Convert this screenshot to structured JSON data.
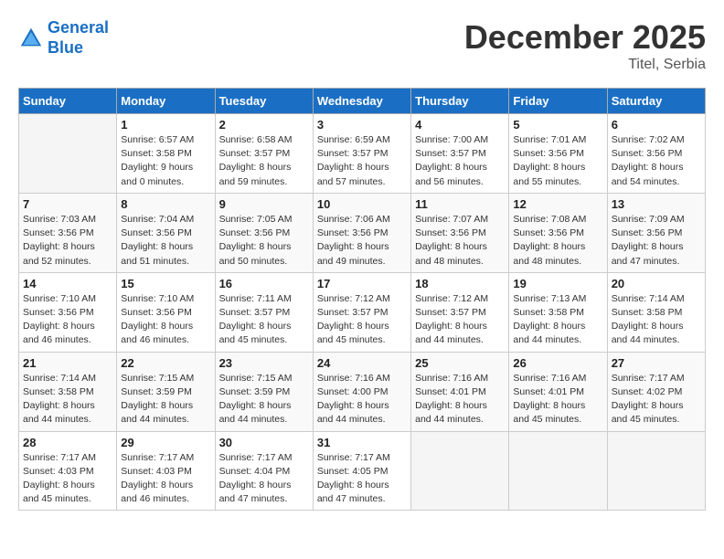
{
  "header": {
    "logo_line1": "General",
    "logo_line2": "Blue",
    "title": "December 2025",
    "subtitle": "Titel, Serbia"
  },
  "columns": [
    "Sunday",
    "Monday",
    "Tuesday",
    "Wednesday",
    "Thursday",
    "Friday",
    "Saturday"
  ],
  "weeks": [
    [
      {
        "day": "",
        "info": ""
      },
      {
        "day": "1",
        "info": "Sunrise: 6:57 AM\nSunset: 3:58 PM\nDaylight: 9 hours\nand 0 minutes."
      },
      {
        "day": "2",
        "info": "Sunrise: 6:58 AM\nSunset: 3:57 PM\nDaylight: 8 hours\nand 59 minutes."
      },
      {
        "day": "3",
        "info": "Sunrise: 6:59 AM\nSunset: 3:57 PM\nDaylight: 8 hours\nand 57 minutes."
      },
      {
        "day": "4",
        "info": "Sunrise: 7:00 AM\nSunset: 3:57 PM\nDaylight: 8 hours\nand 56 minutes."
      },
      {
        "day": "5",
        "info": "Sunrise: 7:01 AM\nSunset: 3:56 PM\nDaylight: 8 hours\nand 55 minutes."
      },
      {
        "day": "6",
        "info": "Sunrise: 7:02 AM\nSunset: 3:56 PM\nDaylight: 8 hours\nand 54 minutes."
      }
    ],
    [
      {
        "day": "7",
        "info": "Sunrise: 7:03 AM\nSunset: 3:56 PM\nDaylight: 8 hours\nand 52 minutes."
      },
      {
        "day": "8",
        "info": "Sunrise: 7:04 AM\nSunset: 3:56 PM\nDaylight: 8 hours\nand 51 minutes."
      },
      {
        "day": "9",
        "info": "Sunrise: 7:05 AM\nSunset: 3:56 PM\nDaylight: 8 hours\nand 50 minutes."
      },
      {
        "day": "10",
        "info": "Sunrise: 7:06 AM\nSunset: 3:56 PM\nDaylight: 8 hours\nand 49 minutes."
      },
      {
        "day": "11",
        "info": "Sunrise: 7:07 AM\nSunset: 3:56 PM\nDaylight: 8 hours\nand 48 minutes."
      },
      {
        "day": "12",
        "info": "Sunrise: 7:08 AM\nSunset: 3:56 PM\nDaylight: 8 hours\nand 48 minutes."
      },
      {
        "day": "13",
        "info": "Sunrise: 7:09 AM\nSunset: 3:56 PM\nDaylight: 8 hours\nand 47 minutes."
      }
    ],
    [
      {
        "day": "14",
        "info": "Sunrise: 7:10 AM\nSunset: 3:56 PM\nDaylight: 8 hours\nand 46 minutes."
      },
      {
        "day": "15",
        "info": "Sunrise: 7:10 AM\nSunset: 3:56 PM\nDaylight: 8 hours\nand 46 minutes."
      },
      {
        "day": "16",
        "info": "Sunrise: 7:11 AM\nSunset: 3:57 PM\nDaylight: 8 hours\nand 45 minutes."
      },
      {
        "day": "17",
        "info": "Sunrise: 7:12 AM\nSunset: 3:57 PM\nDaylight: 8 hours\nand 45 minutes."
      },
      {
        "day": "18",
        "info": "Sunrise: 7:12 AM\nSunset: 3:57 PM\nDaylight: 8 hours\nand 44 minutes."
      },
      {
        "day": "19",
        "info": "Sunrise: 7:13 AM\nSunset: 3:58 PM\nDaylight: 8 hours\nand 44 minutes."
      },
      {
        "day": "20",
        "info": "Sunrise: 7:14 AM\nSunset: 3:58 PM\nDaylight: 8 hours\nand 44 minutes."
      }
    ],
    [
      {
        "day": "21",
        "info": "Sunrise: 7:14 AM\nSunset: 3:58 PM\nDaylight: 8 hours\nand 44 minutes."
      },
      {
        "day": "22",
        "info": "Sunrise: 7:15 AM\nSunset: 3:59 PM\nDaylight: 8 hours\nand 44 minutes."
      },
      {
        "day": "23",
        "info": "Sunrise: 7:15 AM\nSunset: 3:59 PM\nDaylight: 8 hours\nand 44 minutes."
      },
      {
        "day": "24",
        "info": "Sunrise: 7:16 AM\nSunset: 4:00 PM\nDaylight: 8 hours\nand 44 minutes."
      },
      {
        "day": "25",
        "info": "Sunrise: 7:16 AM\nSunset: 4:01 PM\nDaylight: 8 hours\nand 44 minutes."
      },
      {
        "day": "26",
        "info": "Sunrise: 7:16 AM\nSunset: 4:01 PM\nDaylight: 8 hours\nand 45 minutes."
      },
      {
        "day": "27",
        "info": "Sunrise: 7:17 AM\nSunset: 4:02 PM\nDaylight: 8 hours\nand 45 minutes."
      }
    ],
    [
      {
        "day": "28",
        "info": "Sunrise: 7:17 AM\nSunset: 4:03 PM\nDaylight: 8 hours\nand 45 minutes."
      },
      {
        "day": "29",
        "info": "Sunrise: 7:17 AM\nSunset: 4:03 PM\nDaylight: 8 hours\nand 46 minutes."
      },
      {
        "day": "30",
        "info": "Sunrise: 7:17 AM\nSunset: 4:04 PM\nDaylight: 8 hours\nand 47 minutes."
      },
      {
        "day": "31",
        "info": "Sunrise: 7:17 AM\nSunset: 4:05 PM\nDaylight: 8 hours\nand 47 minutes."
      },
      {
        "day": "",
        "info": ""
      },
      {
        "day": "",
        "info": ""
      },
      {
        "day": "",
        "info": ""
      }
    ]
  ]
}
